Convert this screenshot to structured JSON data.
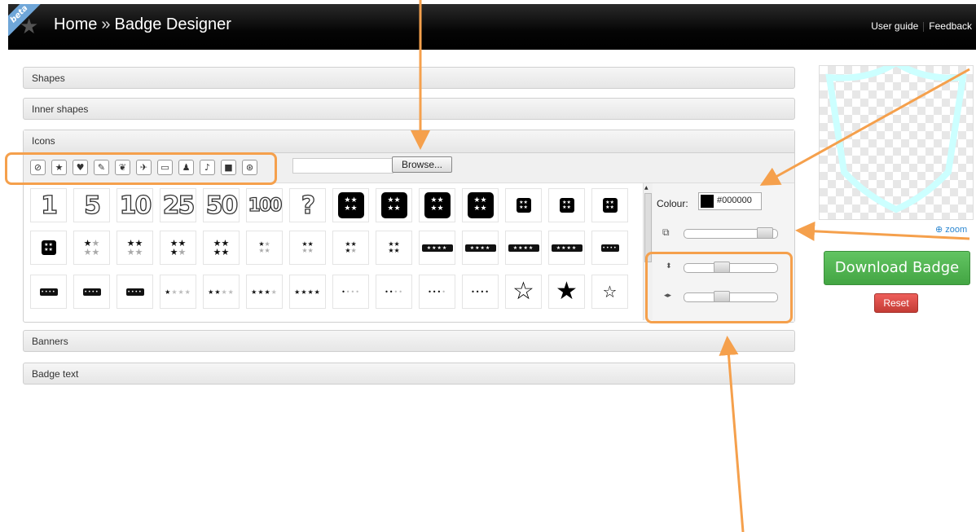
{
  "header": {
    "beta_badge": "beta",
    "breadcrumb_home": "Home",
    "breadcrumb_sep": "»",
    "breadcrumb_page": "Badge Designer",
    "links": [
      "User guide",
      "Feedback"
    ]
  },
  "accordion": {
    "shapes": "Shapes",
    "inner_shapes": "Inner shapes",
    "icons": "Icons",
    "banners": "Banners",
    "badge_text": "Badge text"
  },
  "icon_categories": [
    "no-entry-icon",
    "star-icon",
    "trophy-icon",
    "pen-icon",
    "leaf-icon",
    "airplane-icon",
    "laptop-icon",
    "person-icon",
    "microphone-icon",
    "camera-icon",
    "lifebuoy-icon"
  ],
  "browse_button": "Browse...",
  "icon_grid": {
    "row1_numbers": [
      "1",
      "5",
      "10",
      "25",
      "50",
      "100",
      "?"
    ],
    "row2_counts": [
      [
        "★",
        "★★",
        "★★",
        "★★"
      ]
    ],
    "number_symbols": [
      "1",
      "5",
      "10",
      "25",
      "50",
      "100"
    ]
  },
  "controls": {
    "colour_label": "Colour:",
    "colour_value": "#000000",
    "colour_hex": "#000000",
    "size_level": 0.95,
    "vertical_level": 0.38,
    "horizontal_level": 0.38
  },
  "preview": {
    "zoom_label": "zoom",
    "shield_color": "#ccffff"
  },
  "actions": {
    "download": "Download Badge",
    "reset": "Reset"
  },
  "annotation_color": "#f5a04c"
}
